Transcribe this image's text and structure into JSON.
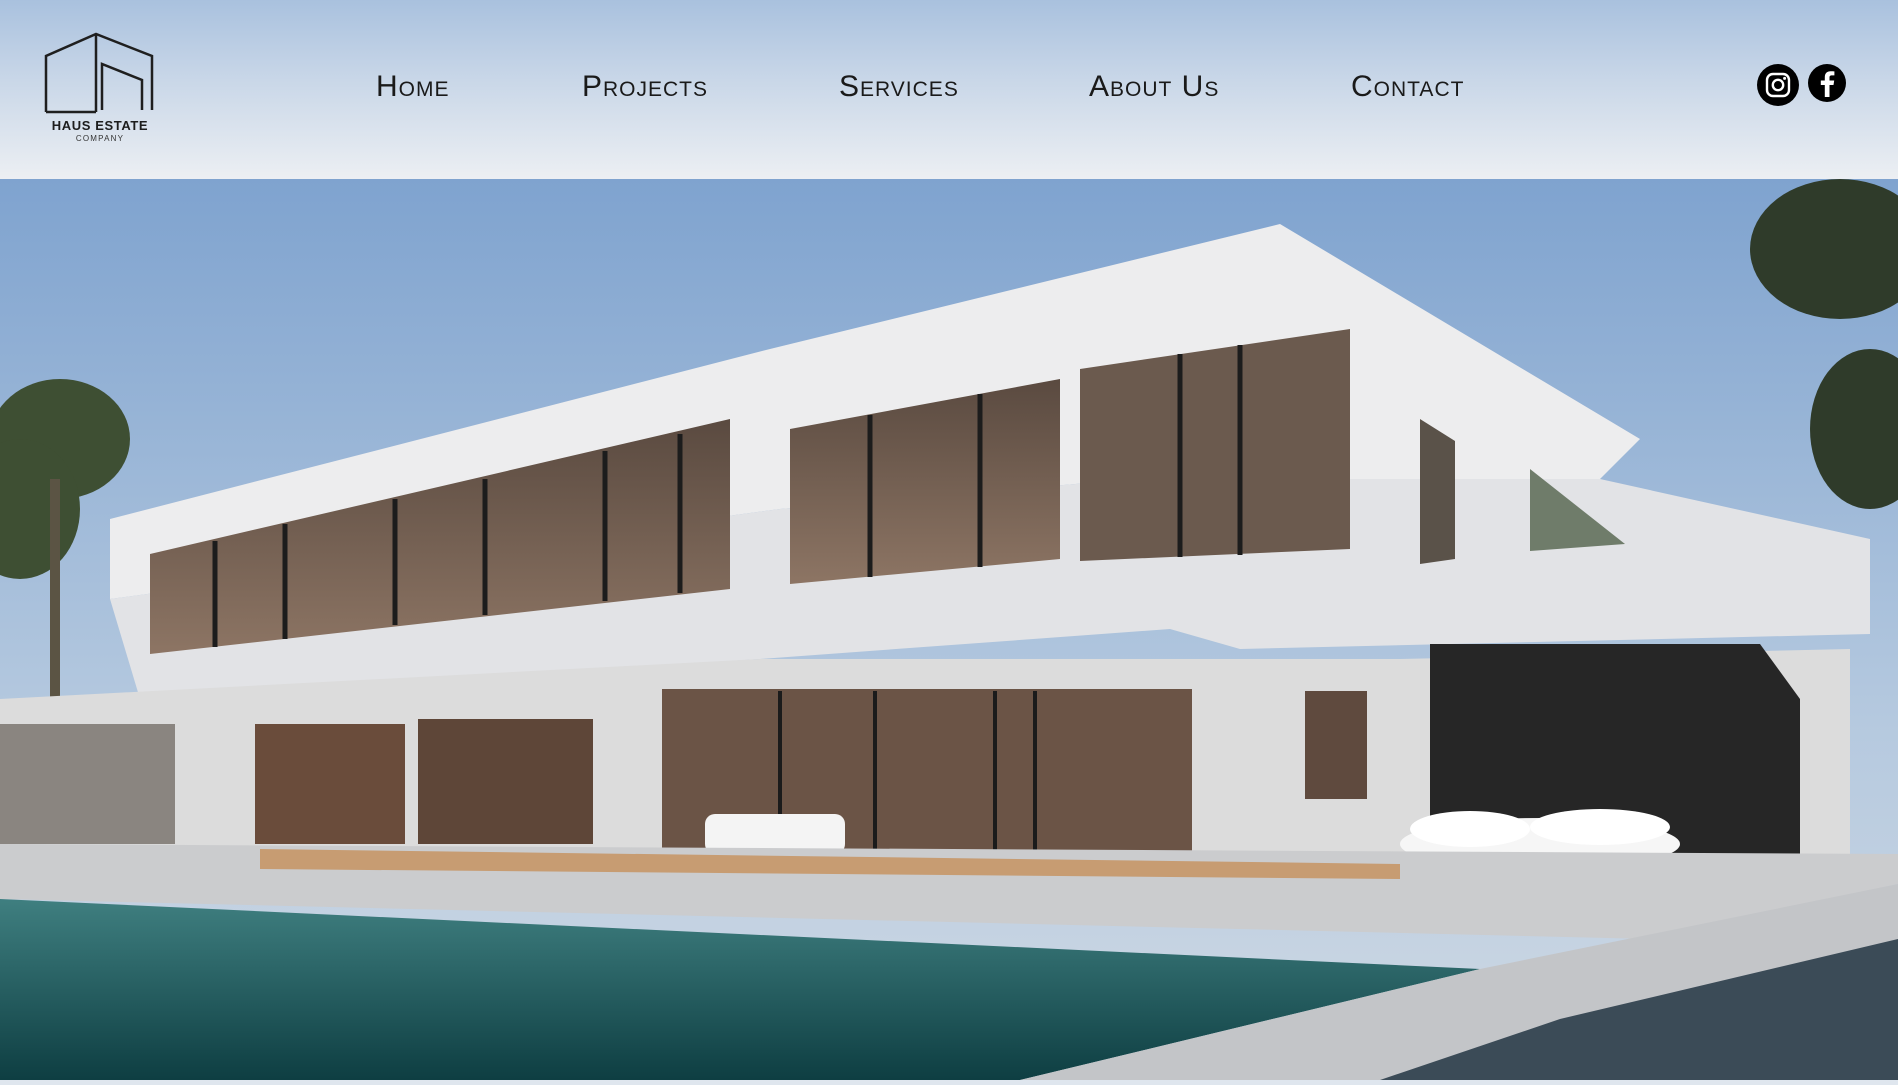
{
  "brand": {
    "name": "HAUS ESTATE",
    "subtitle": "COMPANY",
    "logo_icon": "house-outline-logo"
  },
  "nav": [
    {
      "label": "Home"
    },
    {
      "label": "Projects"
    },
    {
      "label": "Services"
    },
    {
      "label": "About Us"
    },
    {
      "label": "Contact"
    }
  ],
  "social": [
    {
      "icon": "instagram-icon"
    },
    {
      "icon": "facebook-icon"
    }
  ],
  "hero": {
    "image": "modern-white-villa-with-pool-photo"
  },
  "colors": {
    "nav_text": "#1a1a1a",
    "header_top": "#a9c1de",
    "header_bottom": "#eceff3",
    "social_bg": "#000000"
  }
}
